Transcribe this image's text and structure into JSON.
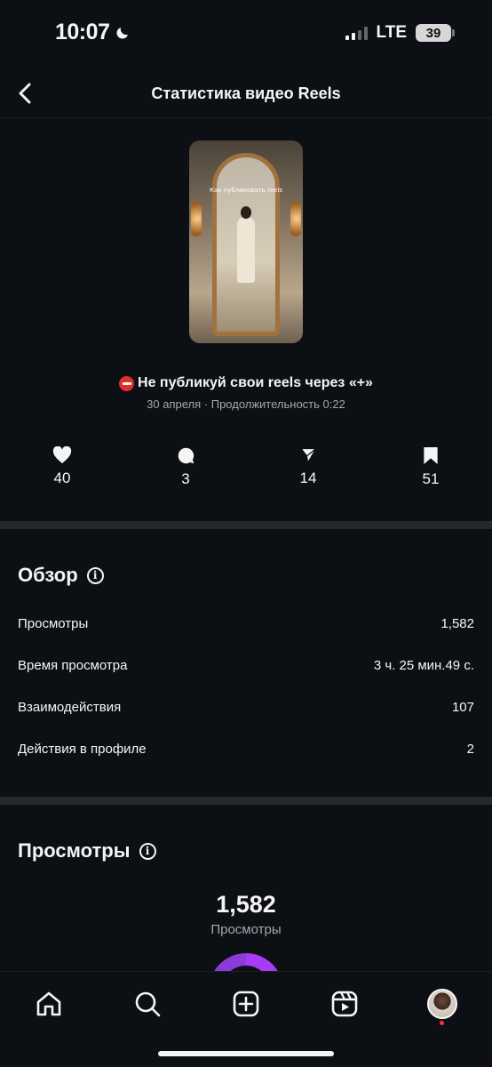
{
  "status_bar": {
    "time": "10:07",
    "network": "LTE",
    "battery": "39"
  },
  "header": {
    "title": "Статистика видео Reels"
  },
  "reel": {
    "thumbnail_caption": "Как публиковать reels",
    "title": "Не публикуй свои reels через «+»",
    "meta": "30 апреля · Продолжительность 0:22"
  },
  "engagement": {
    "likes": "40",
    "comments": "3",
    "shares": "14",
    "saves": "51"
  },
  "overview": {
    "title": "Обзор",
    "rows": [
      {
        "label": "Просмотры",
        "value": "1,582"
      },
      {
        "label": "Время просмотра",
        "value": "3 ч. 25 мин.49 с."
      },
      {
        "label": "Взаимодействия",
        "value": "107"
      },
      {
        "label": "Действия в профиле",
        "value": "2"
      }
    ]
  },
  "views": {
    "title": "Просмотры",
    "total": "1,582",
    "label": "Просмотры"
  },
  "colors": {
    "background": "#0c0f14",
    "separator": "#25282d",
    "muted_text": "#a4a8ae",
    "donut_primary": "#a63cf5",
    "donut_secondary": "#d044d9",
    "notification": "#ff3040"
  },
  "icons": {
    "back": "chevron-left-icon",
    "likes": "heart-icon",
    "comments": "comment-bubble-icon",
    "shares": "send-icon",
    "saves": "bookmark-icon",
    "info": "info-icon",
    "nav": [
      "home-icon",
      "search-icon",
      "create-plus-icon",
      "reels-icon",
      "profile-avatar"
    ]
  }
}
